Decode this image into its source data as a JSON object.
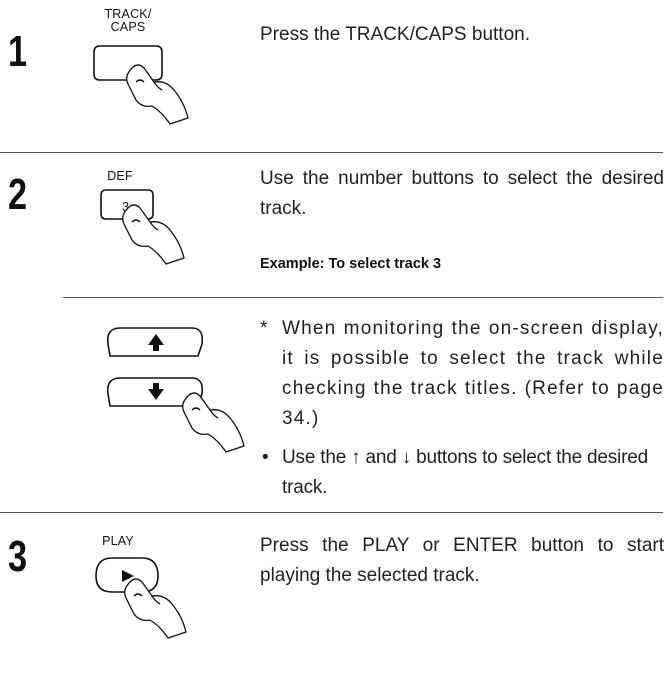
{
  "steps": [
    {
      "number": "1",
      "button_label_line1": "TRACK/",
      "button_label_line2": "CAPS",
      "text": "Press the TRACK/CAPS button."
    },
    {
      "number": "2",
      "button_label": "DEF",
      "button_key": "3",
      "text": "Use the number buttons to select the desired track.",
      "example": "Example:  To select track 3",
      "note": "When monitoring the on-screen display, it is possible to select the track while checking the track titles. (Refer to page 34.)",
      "note_mark": "*",
      "bullet": "Use the ↑ and ↓ buttons to select the desired track.",
      "bullet_mark": "•"
    },
    {
      "number": "3",
      "button_label": "PLAY",
      "text": "Press the PLAY or ENTER button to start playing the selected track."
    }
  ],
  "icons": [
    "hand-press-icon",
    "up-arrow-icon",
    "down-arrow-icon",
    "play-triangle-icon"
  ]
}
